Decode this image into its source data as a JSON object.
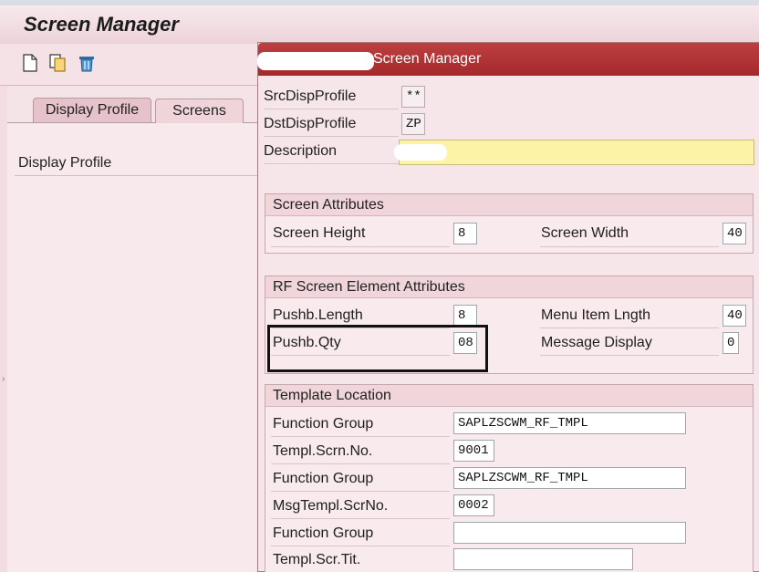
{
  "window": {
    "title": "Screen Manager"
  },
  "toolbar": {
    "icons": [
      "new-document-icon",
      "copy-icon",
      "delete-icon"
    ]
  },
  "tabs": [
    {
      "label": "Display Profile",
      "active": true
    },
    {
      "label": "Screens",
      "active": false
    }
  ],
  "left_panel": {
    "label": "Display Profile"
  },
  "dialog": {
    "title": "Screen Manager",
    "src_disp_profile": {
      "label": "SrcDispProfile",
      "value": "**"
    },
    "dst_disp_profile": {
      "label": "DstDispProfile",
      "value": "ZP"
    },
    "description": {
      "label": "Description",
      "value": ""
    },
    "screen_attributes": {
      "title": "Screen Attributes",
      "screen_height": {
        "label": "Screen Height",
        "value": "8"
      },
      "screen_width": {
        "label": "Screen Width",
        "value": "40"
      }
    },
    "rf_element_attributes": {
      "title": "RF Screen Element Attributes",
      "pushb_length": {
        "label": "Pushb.Length",
        "value": "8"
      },
      "menu_item_length": {
        "label": "Menu Item Lngth",
        "value": "40"
      },
      "pushb_qty": {
        "label": "Pushb.Qty",
        "value": "08"
      },
      "message_display": {
        "label": "Message Display",
        "value": "0"
      }
    },
    "template_location": {
      "title": "Template Location",
      "function_group_1": {
        "label": "Function Group",
        "value": "SAPLZSCWM_RF_TMPL"
      },
      "templ_scrn_no": {
        "label": "Templ.Scrn.No.",
        "value": "9001"
      },
      "function_group_2": {
        "label": "Function Group",
        "value": "SAPLZSCWM_RF_TMPL"
      },
      "msg_templ_scrno": {
        "label": "MsgTempl.ScrNo.",
        "value": "0002"
      },
      "function_group_3": {
        "label": "Function Group",
        "value": ""
      },
      "templ_scr_tit": {
        "label": "Templ.Scr.Tit.",
        "value": ""
      }
    }
  },
  "colors": {
    "dialog_title_bg": "#a5292b",
    "panel_bg": "#f6e6ea",
    "highlight": "#fdf3a6"
  }
}
